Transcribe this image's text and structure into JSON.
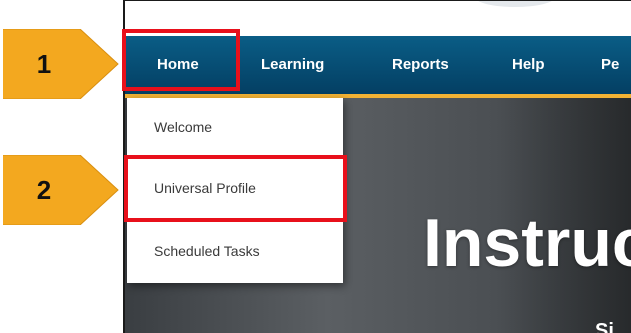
{
  "nav": {
    "items": [
      {
        "label": "Home"
      },
      {
        "label": "Learning"
      },
      {
        "label": "Reports"
      },
      {
        "label": "Help"
      },
      {
        "label": "Pe"
      }
    ]
  },
  "home_menu": {
    "items": [
      {
        "label": "Welcome"
      },
      {
        "label": "Universal Profile"
      },
      {
        "label": "Scheduled Tasks"
      }
    ]
  },
  "hero": {
    "title": "Instruc",
    "subtitle": "Si"
  },
  "callouts": [
    {
      "number": "1"
    },
    {
      "number": "2"
    }
  ],
  "colors": {
    "nav_bg": "#064d75",
    "nav_accent": "#f2b234",
    "highlight_border": "#e8101b",
    "callout_fill": "#f3a81f"
  }
}
